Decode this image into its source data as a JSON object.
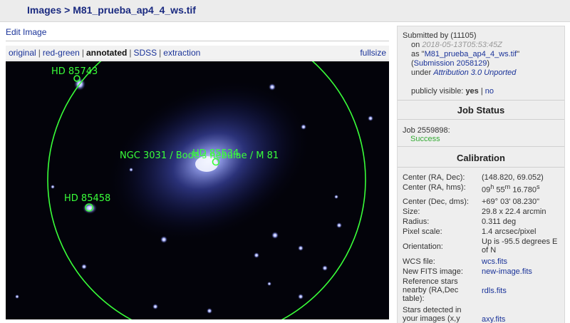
{
  "breadcrumb": {
    "images": "Images",
    "sep": ">",
    "filename": "M81_prueba_ap4_4_ws.tif"
  },
  "edit_image": "Edit Image",
  "view_tabs": {
    "original": "original",
    "red_green": "red-green",
    "annotated": "annotated",
    "sdss": "SDSS",
    "extraction": "extraction",
    "fullsize": "fullsize",
    "sep": "|"
  },
  "annotations": {
    "hd85743": "HD 85743",
    "ngc3031": "NGC 3031 / Bode's nebulae / M 81",
    "hd85534": "HD 85534",
    "hd85458": "HD 85458"
  },
  "submission": {
    "submitted_by": "Submitted by (11105)",
    "on_label": "on",
    "on_value": "2018-05-13T05:53:45Z",
    "as_prefix": "as \"",
    "as_link": "M81_prueba_ap4_4_ws.tif",
    "as_suffix": "\"",
    "sub_open": "(",
    "sub_link": "Submission 2058129",
    "sub_close": ")",
    "under_label": "under",
    "license": "Attribution 3.0 Unported",
    "visible_label": "publicly visible:",
    "visible_yes": "yes",
    "visible_sep": "|",
    "visible_no": "no"
  },
  "job_status": {
    "heading": "Job Status",
    "job": "Job 2559898:",
    "status": "Success"
  },
  "calibration": {
    "heading": "Calibration",
    "rows": [
      {
        "k": "Center (RA, Dec):",
        "v": "(148.820, 69.052)"
      },
      {
        "k": "Center (RA, hms):",
        "v_h": "09",
        "v_hs": "h",
        "v_m": " 55",
        "v_ms": "m",
        "v_s": " 16.780",
        "v_ss": "s"
      },
      {
        "k": "Center (Dec, dms):",
        "v": "+69° 03' 08.230\""
      },
      {
        "k": "Size:",
        "v": "29.8 x 22.4 arcmin"
      },
      {
        "k": "Radius:",
        "v": "0.311 deg"
      },
      {
        "k": "Pixel scale:",
        "v": "1.4 arcsec/pixel"
      },
      {
        "k": "Orientation:",
        "v": "Up is -95.5 degrees E of N"
      },
      {
        "k": "WCS file:",
        "v": "wcs.fits"
      },
      {
        "k": "New FITS image:",
        "v": "new-image.fits"
      },
      {
        "k": "Reference stars nearby (RA,Dec table):",
        "v": "rdls.fits"
      },
      {
        "k": "Stars detected in your images (x,y",
        "v": "axy.fits"
      }
    ]
  },
  "colors": {
    "link": "#1a3399",
    "success": "#33aa33",
    "annotation": "#39ff39",
    "sidebar_bg": "#eeeeee"
  }
}
